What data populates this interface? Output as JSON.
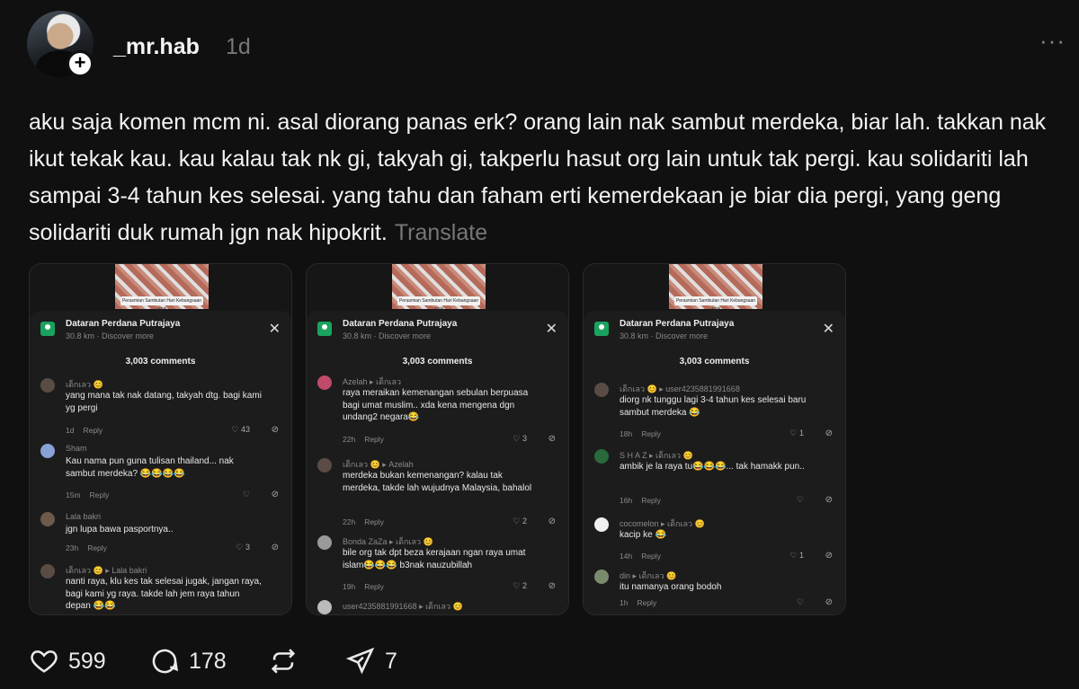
{
  "post": {
    "username": "_mr.hab",
    "timestamp": "1d",
    "text": "aku saja komen mcm ni. asal diorang panas erk? orang lain nak sambut merdeka, biar lah. takkan nak ikut tekak kau. kau kalau tak nk gi, takyah gi, takperlu hasut org lain untuk tak pergi. kau solidariti lah sampai 3-4 tahun kes selesai. yang tahu dan faham erti kemerdekaan je biar dia pergi, yang geng solidariti duk rumah jgn nak hipokrit.",
    "translate_label": "Translate",
    "follow_badge": "+",
    "more_icon": "more-icon"
  },
  "actions": {
    "likes": "599",
    "comments": "178",
    "reposts": "",
    "shares": "7"
  },
  "screenshots": [
    {
      "photo_caption": "Perasmian Sambutan Hari Kebangsaan 2025",
      "location_title": "Dataran Perdana Putrajaya",
      "location_sub": "30.8 km · Discover more",
      "comment_count": "3,003 comments",
      "comments": [
        {
          "who": "เด็กเลว 😊",
          "body": "yang mana tak nak datang, takyah dtg. bagi kami yg pergi",
          "time": "1d",
          "reply": "Reply",
          "likes": "43"
        },
        {
          "who": "Sham",
          "body": "Kau nama pun guna tulisan thailand... nak sambut merdeka? 😂😂😂😂",
          "time": "15m",
          "reply": "Reply",
          "likes": ""
        },
        {
          "who": "Lala bakri",
          "body": "jgn lupa bawa pasportnya..",
          "time": "23h",
          "reply": "Reply",
          "likes": "3"
        },
        {
          "who": "เด็กเลว 😊 ▸ Lala bakri",
          "body": "nanti raya, klu kes tak selesai jugak, jangan raya, bagi kami yg raya. takde lah jem raya tahun depan 😂😂",
          "time": "",
          "reply": "",
          "likes": ""
        }
      ]
    },
    {
      "photo_caption": "Perasmian Sambutan Hari Kebangsaan 2025",
      "location_title": "Dataran Perdana Putrajaya",
      "location_sub": "30.8 km · Discover more",
      "comment_count": "3,003 comments",
      "comments": [
        {
          "who": "Azelah ▸ เด็กเลว",
          "body": "raya meraikan kemenangan sebulan berpuasa bagi umat muslim.. xda kena mengena dgn undang2 negara😂",
          "time": "22h",
          "reply": "Reply",
          "likes": "3"
        },
        {
          "who": "เด็กเลว 😊 ▸ Azelah",
          "body": "merdeka bukan kemenangan? kalau tak merdeka, takde lah wujudnya Malaysia, bahalol",
          "time": "22h",
          "reply": "Reply",
          "likes": "2"
        },
        {
          "who": "Bonda ZaZa ▸ เด็กเลว 😊",
          "body": "bile org tak dpt beza kerajaan ngan raya umat islam😂😂😂 b3nak nauzubillah",
          "time": "19h",
          "reply": "Reply",
          "likes": "2"
        },
        {
          "who": "user4235881991668 ▸ เด็กเลว 😊",
          "body": "",
          "time": "",
          "reply": "",
          "likes": ""
        }
      ]
    },
    {
      "photo_caption": "Perasmian Sambutan Hari Kebangsaan 2025",
      "location_title": "Dataran Perdana Putrajaya",
      "location_sub": "30.8 km · Discover more",
      "comment_count": "3,003 comments",
      "comments": [
        {
          "who": "เด็กเลว 😊 ▸ user4235881991668",
          "body": "diorg nk tunggu lagi 3-4 tahun kes selesai baru sambut merdeka 😂",
          "time": "18h",
          "reply": "Reply",
          "likes": "1"
        },
        {
          "who": "S H A Z ▸ เด็กเลว 😊",
          "body": "ambik je la raya tu😂😂😂... tak hamakk pun..",
          "time": "16h",
          "reply": "Reply",
          "likes": ""
        },
        {
          "who": "cocomelon ▸ เด็กเลว 😊",
          "body": "kacip ke 😂",
          "time": "14h",
          "reply": "Reply",
          "likes": "1"
        },
        {
          "who": "din ▸ เด็กเลว 😊",
          "body": "itu namanya orang bodoh",
          "time": "1h",
          "reply": "Reply",
          "likes": ""
        }
      ]
    }
  ],
  "colors": {
    "background": "#101010",
    "text": "#f3f3f3",
    "muted": "#777777"
  }
}
